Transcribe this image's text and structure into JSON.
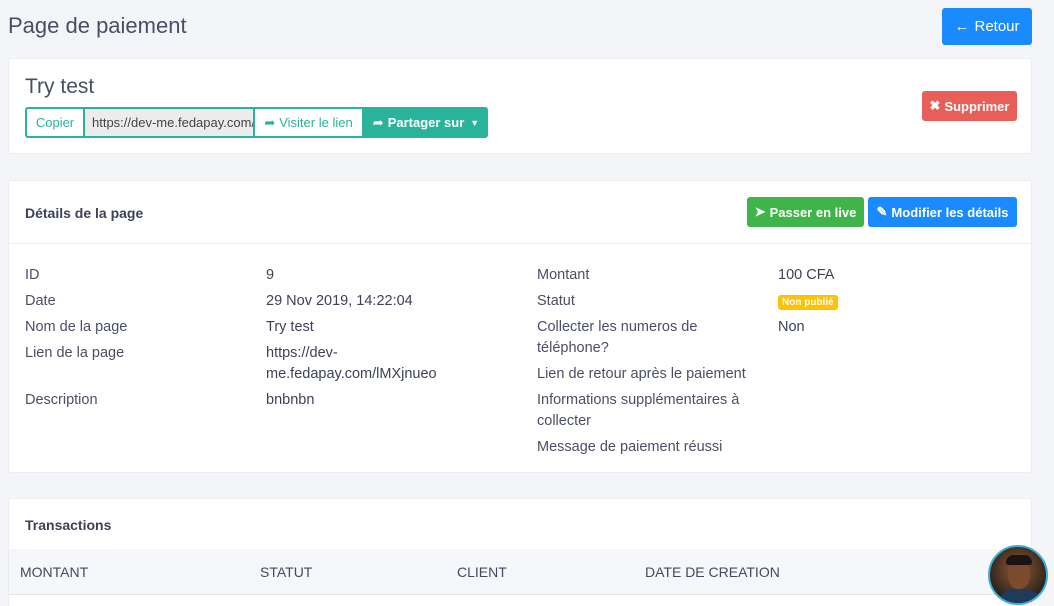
{
  "header": {
    "title": "Page de paiement",
    "back_label": "Retour"
  },
  "summary": {
    "name": "Try test",
    "copy_label": "Copier",
    "link_value": "https://dev-me.fedapay.com/lMXjnueo",
    "visit_label": "Visiter le lien",
    "share_label": "Partager sur",
    "delete_label": "Supprimer"
  },
  "details": {
    "heading": "Détails de la page",
    "go_live_label": "Passer en live",
    "edit_label": "Modifier les détails",
    "left": [
      {
        "label": "ID",
        "value": "9"
      },
      {
        "label": "Date",
        "value": "29 Nov 2019, 14:22:04"
      },
      {
        "label": "Nom de la page",
        "value": "Try test"
      },
      {
        "label": "Lien de la page",
        "value_line1": "https://dev-",
        "value_line2": "me.fedapay.com/lMXjnueo"
      },
      {
        "label": "Description",
        "value": "bnbnbn"
      }
    ],
    "right": [
      {
        "label": "Montant",
        "value": "100 CFA"
      },
      {
        "label": "Statut",
        "badge": "Non publié"
      },
      {
        "label_line1": "Collecter les numeros de",
        "label_line2": "téléphone?",
        "value": "Non"
      },
      {
        "label": "Lien de retour après le paiement"
      },
      {
        "label_line1": "Informations supplémentaires à",
        "label_line2": "collecter"
      },
      {
        "label": "Message de paiement réussi"
      }
    ]
  },
  "transactions": {
    "heading": "Transactions",
    "columns": [
      "MONTANT",
      "STATUT",
      "CLIENT",
      "DATE DE CREATION"
    ]
  },
  "colors": {
    "primary": "#1a8bff",
    "teal": "#2ab39b",
    "danger": "#e85e59",
    "success": "#3fb549",
    "warning": "#fdc202"
  }
}
